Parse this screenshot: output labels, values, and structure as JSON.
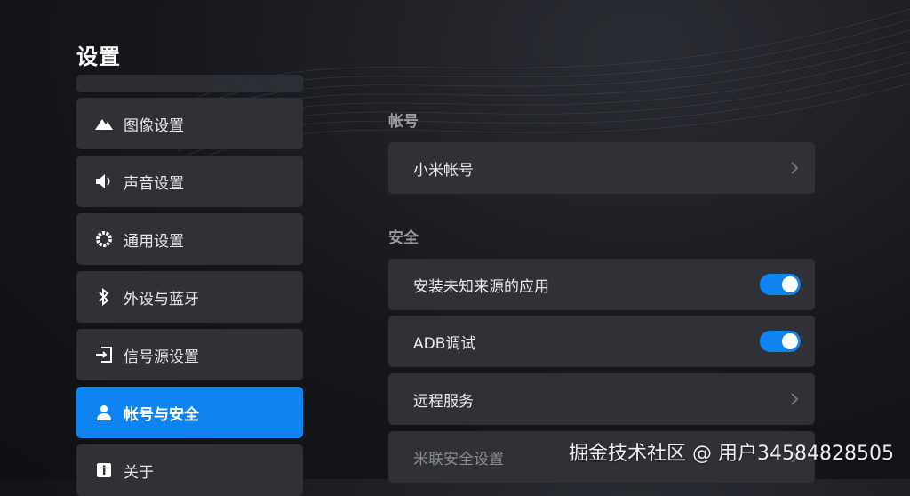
{
  "header": {
    "title": "设置"
  },
  "sidebar": {
    "items": [
      {
        "label": "图像设置",
        "icon": "image-mountain-icon"
      },
      {
        "label": "声音设置",
        "icon": "speaker-icon"
      },
      {
        "label": "通用设置",
        "icon": "gear-icon"
      },
      {
        "label": "外设与蓝牙",
        "icon": "bluetooth-icon"
      },
      {
        "label": "信号源设置",
        "icon": "input-source-icon"
      },
      {
        "label": "帐号与安全",
        "icon": "user-icon",
        "active": true
      },
      {
        "label": "关于",
        "icon": "info-icon"
      }
    ]
  },
  "main": {
    "sections": [
      {
        "title": "帐号",
        "rows": [
          {
            "label": "小米帐号",
            "control": "chevron"
          }
        ]
      },
      {
        "title": "安全",
        "rows": [
          {
            "label": "安装未知来源的应用",
            "control": "toggle",
            "value": "on"
          },
          {
            "label": "ADB调试",
            "control": "toggle",
            "value": "on"
          },
          {
            "label": "远程服务",
            "control": "chevron"
          },
          {
            "label": "米联安全设置",
            "control": "chevron"
          }
        ]
      }
    ]
  },
  "watermark": "掘金技术社区 @ 用户34584828505",
  "colors": {
    "accent": "#0d84f2",
    "card": "#2f3137",
    "background": "#15161a"
  }
}
